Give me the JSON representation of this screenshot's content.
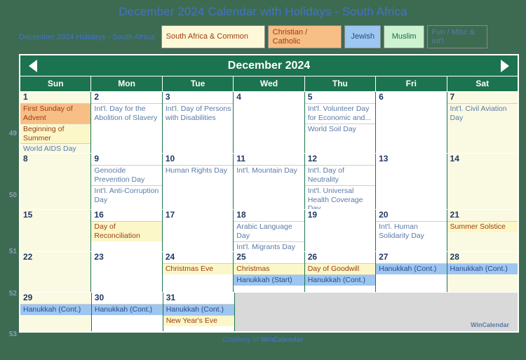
{
  "page": {
    "title": "December 2024 Calendar with Holidays - South Africa",
    "legend_label": "December 2024 Holidays - South Africa:",
    "footer_prefix": "Courtesy of ",
    "footer_brand": "WinCalendar",
    "watermark": "WinCalendar"
  },
  "legend": {
    "items": [
      {
        "label": "South Africa & Common",
        "key": "sa",
        "bg": "#FDF9D8",
        "fg": "#9e3b10"
      },
      {
        "label": "Christian / Catholic",
        "key": "chr",
        "bg": "#F7BE86",
        "fg": "#9e3b10"
      },
      {
        "label": "Jewish",
        "key": "jew",
        "bg": "#9DC6F0",
        "fg": "#2b4b8c"
      },
      {
        "label": "Muslim",
        "key": "mus",
        "bg": "#CCF2CF",
        "fg": "#1d6b4f"
      },
      {
        "label": "Fun / Misc & Int'l",
        "key": "fun",
        "bg": "transparent",
        "fg": "#5b7aa8"
      }
    ]
  },
  "calendar": {
    "month_title": "December 2024",
    "prev_label": "Previous month",
    "next_label": "Next month",
    "weekdays": [
      "Sun",
      "Mon",
      "Tue",
      "Wed",
      "Thu",
      "Fri",
      "Sat"
    ],
    "week_numbers": [
      "49",
      "50",
      "51",
      "52",
      "53"
    ],
    "weeks": [
      [
        {
          "num": "1",
          "weekend": true,
          "events": [
            {
              "text": "First Sunday of Advent",
              "cat": "chr"
            },
            {
              "text": "Beginning of Summer",
              "cat": "sa"
            },
            {
              "text": "World AIDS Day",
              "cat": "fun"
            }
          ]
        },
        {
          "num": "2",
          "weekend": false,
          "events": [
            {
              "text": "Int'l. Day for the Abolition of Slavery",
              "cat": "fun"
            }
          ]
        },
        {
          "num": "3",
          "weekend": false,
          "events": [
            {
              "text": "Int'l. Day of Persons with Disabilities",
              "cat": "fun"
            }
          ]
        },
        {
          "num": "4",
          "weekend": false,
          "events": []
        },
        {
          "num": "5",
          "weekend": false,
          "events": [
            {
              "text": "Int'l. Volunteer Day for Economic and...",
              "cat": "fun"
            },
            {
              "text": "World Soil Day",
              "cat": "fun"
            }
          ]
        },
        {
          "num": "6",
          "weekend": false,
          "events": []
        },
        {
          "num": "7",
          "weekend": true,
          "events": [
            {
              "text": "Int'l. Civil Aviation Day",
              "cat": "fun"
            }
          ]
        }
      ],
      [
        {
          "num": "8",
          "weekend": true,
          "events": []
        },
        {
          "num": "9",
          "weekend": false,
          "events": [
            {
              "text": "Genocide Prevention Day",
              "cat": "fun"
            },
            {
              "text": "Int'l. Anti-Corruption Day",
              "cat": "fun"
            }
          ]
        },
        {
          "num": "10",
          "weekend": false,
          "events": [
            {
              "text": "Human Rights Day",
              "cat": "fun"
            }
          ]
        },
        {
          "num": "11",
          "weekend": false,
          "events": [
            {
              "text": "Int'l. Mountain Day",
              "cat": "fun"
            }
          ]
        },
        {
          "num": "12",
          "weekend": false,
          "events": [
            {
              "text": "Int'l. Day of Neutrality",
              "cat": "fun"
            },
            {
              "text": "Int'l. Universal Health Coverage Day",
              "cat": "fun"
            }
          ]
        },
        {
          "num": "13",
          "weekend": false,
          "events": []
        },
        {
          "num": "14",
          "weekend": true,
          "events": []
        }
      ],
      [
        {
          "num": "15",
          "weekend": true,
          "events": []
        },
        {
          "num": "16",
          "weekend": false,
          "events": [
            {
              "text": "Day of Reconciliation",
              "cat": "sa"
            }
          ]
        },
        {
          "num": "17",
          "weekend": false,
          "events": []
        },
        {
          "num": "18",
          "weekend": false,
          "events": [
            {
              "text": "Arabic Language Day",
              "cat": "fun"
            },
            {
              "text": "Int'l. Migrants Day",
              "cat": "fun"
            }
          ]
        },
        {
          "num": "19",
          "weekend": false,
          "events": []
        },
        {
          "num": "20",
          "weekend": false,
          "events": [
            {
              "text": "Int'l. Human Solidarity Day",
              "cat": "fun"
            }
          ]
        },
        {
          "num": "21",
          "weekend": true,
          "events": [
            {
              "text": "Summer Solstice",
              "cat": "sa"
            }
          ]
        }
      ],
      [
        {
          "num": "22",
          "weekend": true,
          "events": []
        },
        {
          "num": "23",
          "weekend": false,
          "events": []
        },
        {
          "num": "24",
          "weekend": false,
          "events": [
            {
              "text": "Christmas Eve",
              "cat": "sa"
            }
          ]
        },
        {
          "num": "25",
          "weekend": false,
          "events": [
            {
              "text": "Christmas",
              "cat": "sa"
            },
            {
              "text": "Hanukkah (Start)",
              "cat": "jew"
            }
          ]
        },
        {
          "num": "26",
          "weekend": false,
          "events": [
            {
              "text": "Day of Goodwill",
              "cat": "sa"
            },
            {
              "text": "Hanukkah (Cont.)",
              "cat": "jew"
            }
          ]
        },
        {
          "num": "27",
          "weekend": false,
          "events": [
            {
              "text": "Hanukkah (Cont.)",
              "cat": "jew"
            }
          ]
        },
        {
          "num": "28",
          "weekend": true,
          "events": [
            {
              "text": "Hanukkah (Cont.)",
              "cat": "jew"
            }
          ]
        }
      ],
      [
        {
          "num": "29",
          "weekend": true,
          "events": [
            {
              "text": "Hanukkah (Cont.)",
              "cat": "jew"
            }
          ]
        },
        {
          "num": "30",
          "weekend": false,
          "events": [
            {
              "text": "Hanukkah (Cont.)",
              "cat": "jew"
            }
          ]
        },
        {
          "num": "31",
          "weekend": false,
          "events": [
            {
              "text": "Hanukkah (Cont.)",
              "cat": "jew"
            },
            {
              "text": "New Year's Eve",
              "cat": "sa"
            }
          ]
        },
        {
          "num": "",
          "weekend": false,
          "blank": true,
          "events": []
        },
        {
          "num": "",
          "weekend": false,
          "blank": true,
          "events": []
        },
        {
          "num": "",
          "weekend": false,
          "blank": true,
          "events": []
        },
        {
          "num": "",
          "weekend": false,
          "blank": true,
          "events": []
        }
      ]
    ]
  }
}
